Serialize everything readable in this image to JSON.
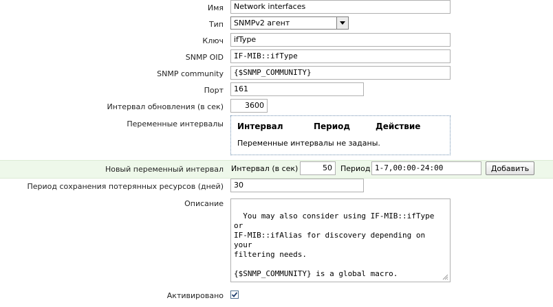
{
  "form": {
    "name": {
      "label": "Имя",
      "value": "Network interfaces"
    },
    "type": {
      "label": "Тип",
      "value": "SNMPv2 агент"
    },
    "key": {
      "label": "Ключ",
      "value": "ifType"
    },
    "snmp_oid": {
      "label": "SNMP OID",
      "value": "IF-MIB::ifType"
    },
    "snmp_community": {
      "label": "SNMP community",
      "value": "{$SNMP_COMMUNITY}"
    },
    "port": {
      "label": "Порт",
      "value": "161"
    },
    "update_interval": {
      "label": "Интервал обновления (в сек)",
      "value": "3600"
    },
    "flex_intervals": {
      "label": "Переменные интервалы",
      "col_interval": "Интервал",
      "col_period": "Период",
      "col_action": "Действие",
      "empty_text": "Переменные интервалы не заданы."
    },
    "new_flex_interval": {
      "label": "Новый переменный интервал",
      "interval_label": "Интервал (в сек)",
      "interval_value": "50",
      "period_label": "Период",
      "period_value": "1-7,00:00-24:00",
      "add_button": "Добавить"
    },
    "lifetime": {
      "label": "Период сохранения потерянных ресурсов (дней)",
      "value": "30"
    },
    "description": {
      "label": "Описание",
      "value": "You may also consider using IF-MIB::ifType or\nIF-MIB::ifAlias for discovery depending on your\nfiltering needs.\n\n{$SNMP_COMMUNITY} is a global macro."
    },
    "enabled": {
      "label": "Активировано",
      "checked": true
    }
  }
}
